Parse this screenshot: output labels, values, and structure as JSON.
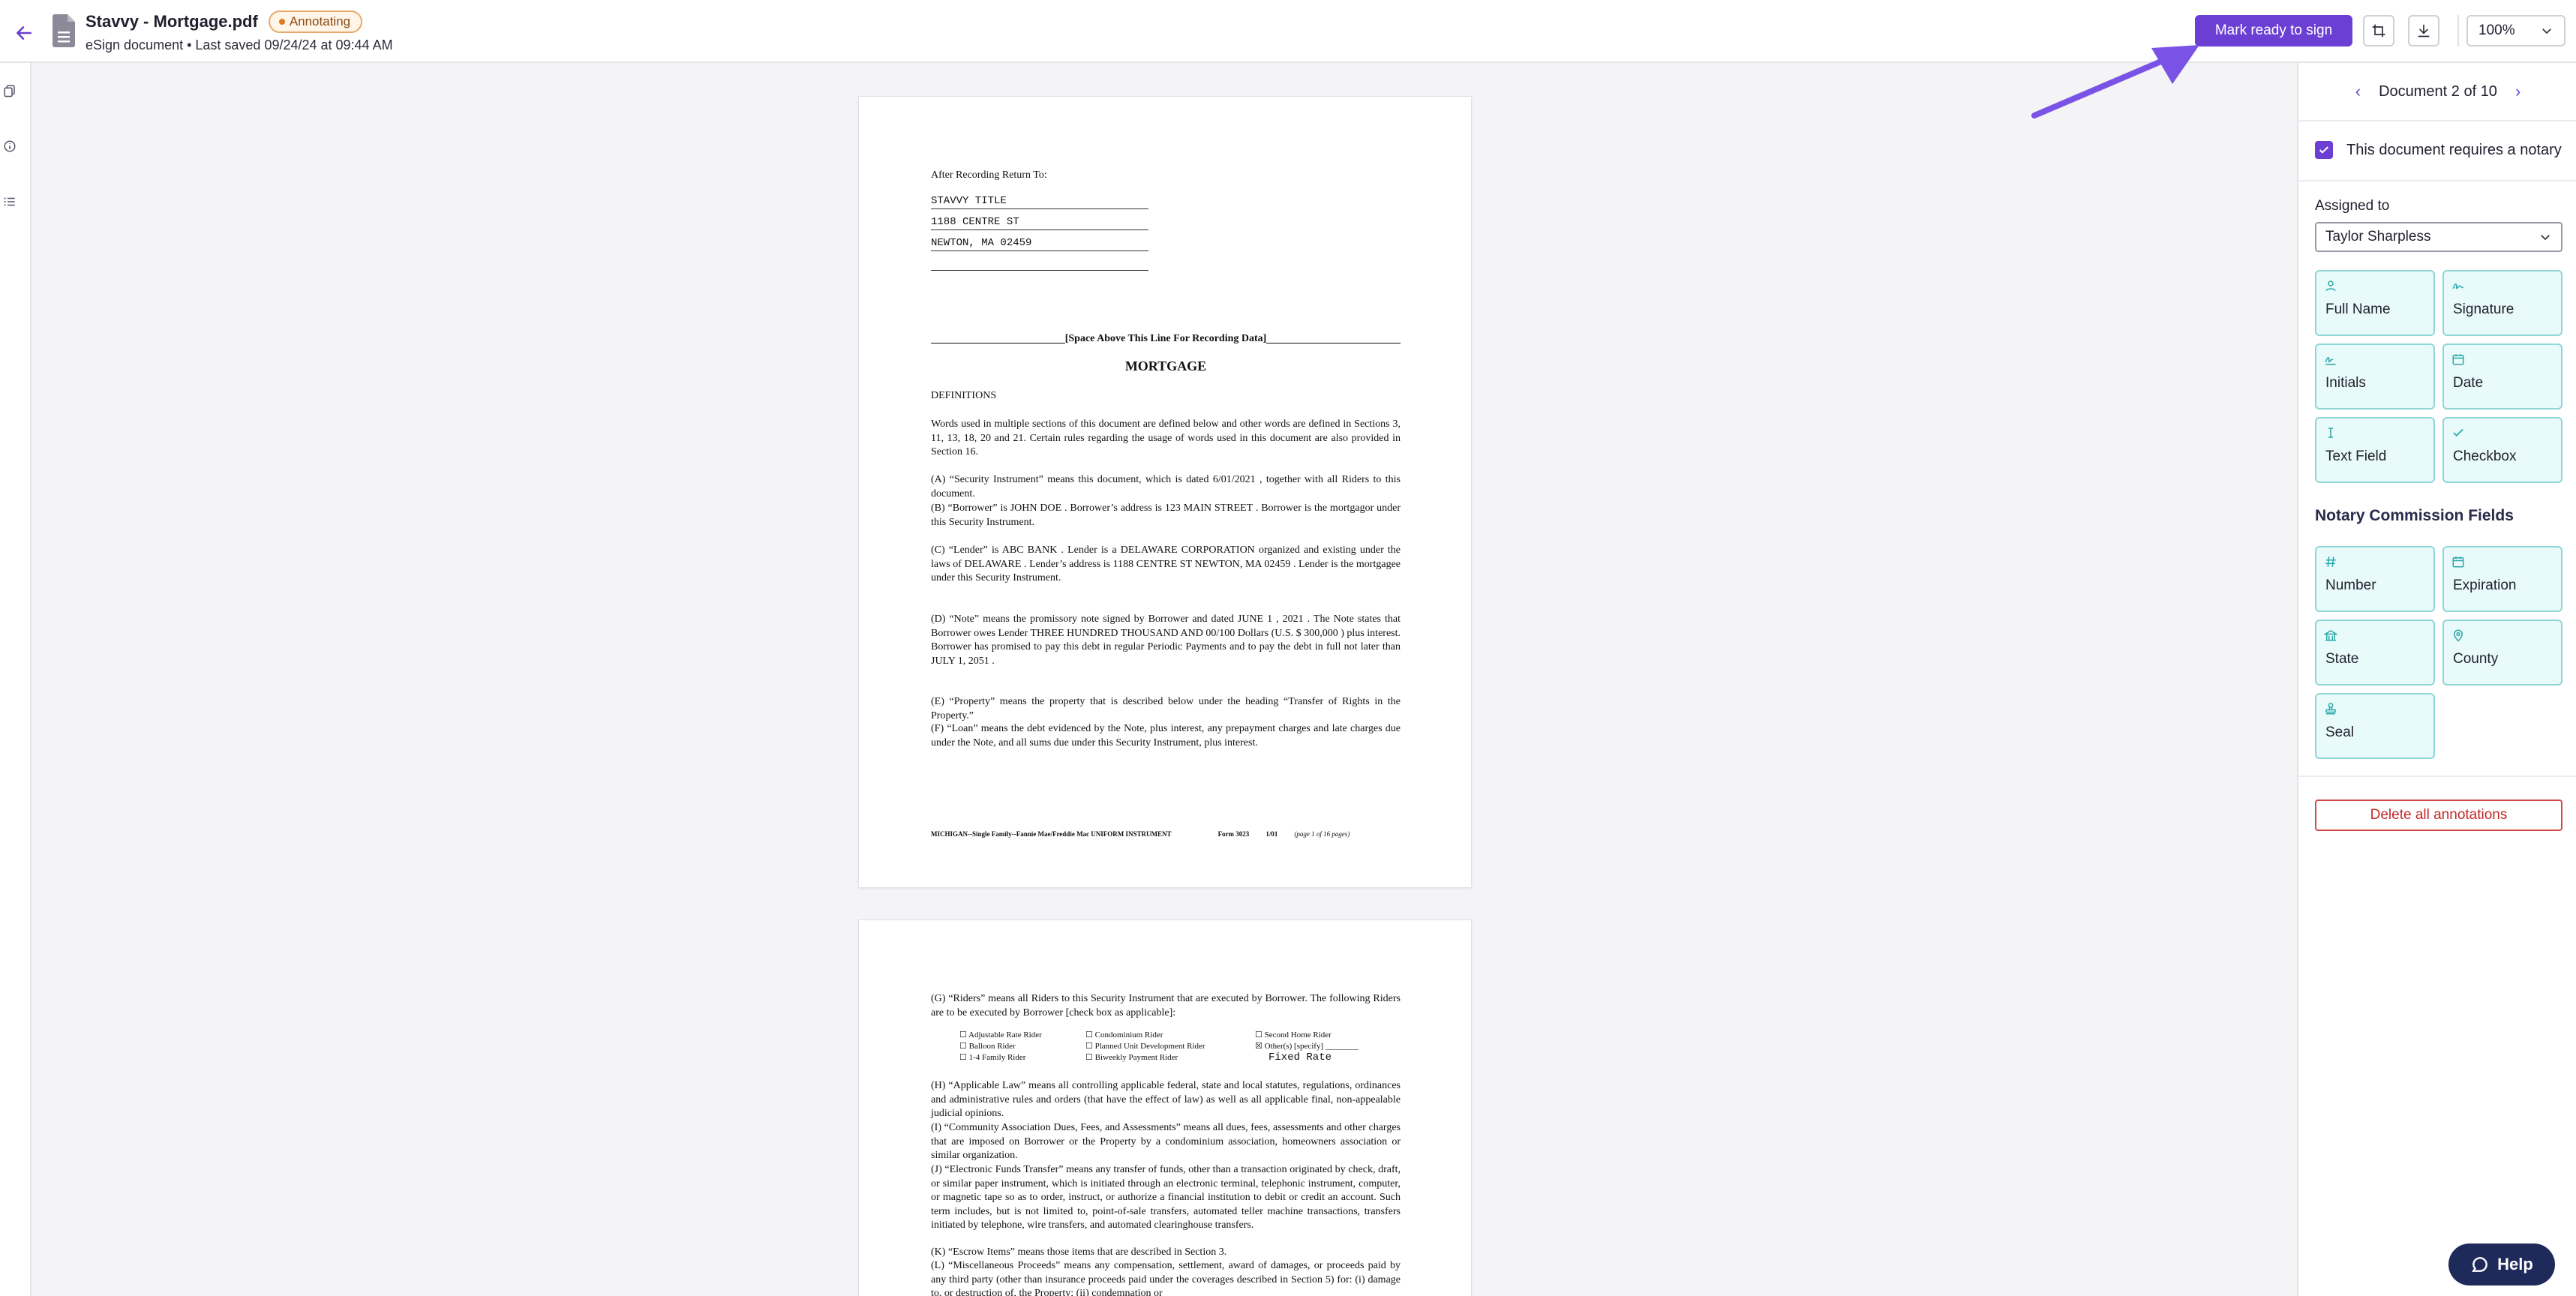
{
  "header": {
    "title": "Stavvy - Mortgage.pdf",
    "badge": "Annotating",
    "subtitle": "eSign document • Last saved 09/24/24 at 09:44 AM",
    "primary_button": "Mark ready to sign",
    "zoom": "100%"
  },
  "colors": {
    "accent": "#6b3fd4",
    "tile_bg": "#e9fafa",
    "tile_border": "#8fd6d6",
    "danger": "#c02a2a",
    "badge": "#e6a96a"
  },
  "icons": {
    "back": "arrow-left-icon",
    "file": "document-icon",
    "crop": "crop-icon",
    "download": "download-icon",
    "chevron": "chevron-down-icon",
    "help": "chat-bubble-icon"
  },
  "panel": {
    "doc_nav": "Document 2 of 10",
    "notary_label": "This document requires a notary",
    "assigned_label": "Assigned to",
    "assigned_value": "Taylor Sharpless",
    "fields": [
      "Full Name",
      "Signature",
      "Initials",
      "Date",
      "Text Field",
      "Checkbox"
    ],
    "notary_section": "Notary Commission Fields",
    "notary_fields": [
      "Number",
      "Expiration",
      "State",
      "County",
      "Seal"
    ],
    "delete_button": "Delete all annotations"
  },
  "help_label": "Help",
  "doc": {
    "return_to": "After Recording Return To:",
    "addr1": "STAVVY TITLE",
    "addr2": "1188 CENTRE ST",
    "addr3": "NEWTON, MA 02459",
    "space_above": "[Space Above This Line For Recording Data]",
    "heading": "MORTGAGE",
    "definitions": "DEFINITIONS",
    "intro": "Words used in multiple sections of this document are defined below and other words are defined in Sections 3, 11, 13, 18, 20 and 21.  Certain rules regarding the usage of words used in this document are also provided in Section 16.",
    "a": "(A)     “Security Instrument” means this document, which is dated  6/01/2021  , together with all Riders to this document.",
    "b": "(B)     “Borrower” is  JOHN DOE  . Borrower’s address is  123 MAIN STREET  . Borrower is the mortgagor under this Security Instrument.",
    "c": "(C)     “Lender” is  ABC BANK  . Lender is a  DELAWARE CORPORATION  organized and existing under the laws of  DELAWARE  . Lender’s address is  1188 CENTRE ST  NEWTON, MA 02459  . Lender is the mortgagee under this Security Instrument.",
    "d": "(D)     “Note” means the promissory note signed by Borrower and dated  JUNE 1 ,  2021  . The Note states that Borrower owes Lender  THREE HUNDRED THOUSAND AND 00/100  Dollars (U.S. $ 300,000  ) plus interest. Borrower has promised to pay this debt in regular Periodic Payments and to pay the debt in full not later than  JULY 1, 2051  .",
    "e": "(E)     “Property” means the property that is described below under the heading “Transfer of Rights in the Property.”",
    "f": "(F)     “Loan” means the debt evidenced by the Note, plus interest, any prepayment charges and late charges due under the Note, and all sums due under this Security Instrument, plus interest.",
    "footer_left": "MICHIGAN--Single Family--Fannie Mae/Freddie Mac UNIFORM INSTRUMENT",
    "footer_form": "Form 3023",
    "footer_date": "1/01",
    "footer_page": "(page 1 of 16 pages)",
    "g": "(G)     “Riders” means all Riders to this Security Instrument that are executed by Borrower. The following Riders are to be executed by Borrower [check box as applicable]:",
    "riders_col1": [
      "Adjustable Rate Rider",
      "Balloon Rider",
      "1-4 Family Rider"
    ],
    "riders_col2": [
      "Condominium Rider",
      "Planned Unit Development Rider",
      "Biweekly Payment Rider"
    ],
    "riders_col3": [
      "Second Home Rider",
      "Other(s) [specify]"
    ],
    "rider_other": "Fixed Rate",
    "h": "(H)     “Applicable Law” means all controlling applicable federal, state and local statutes, regulations, ordinances and administrative rules and orders (that have the effect of law) as well as all applicable final, non-appealable judicial opinions.",
    "i": "(I)     “Community Association Dues, Fees, and Assessments” means all dues, fees, assessments and other charges that are imposed on Borrower or the Property by a condominium association, homeowners association or similar organization.",
    "j": "(J)     “Electronic Funds Transfer” means any transfer of funds, other than a transaction originated by check, draft, or similar paper instrument, which is initiated through an electronic terminal, telephonic instrument, computer, or magnetic tape so as to order, instruct, or authorize a financial institution to debit or credit an account.  Such term includes, but is not limited to, point-of-sale transfers, automated teller machine transactions, transfers initiated by telephone, wire transfers, and automated clearinghouse transfers.",
    "k": "(K)     “Escrow Items” means those items that are described in Section 3.",
    "l": "(L)     “Miscellaneous Proceeds” means any compensation, settlement, award of damages, or proceeds paid by any third party (other than insurance proceeds paid under the coverages described in Section 5) for: (i) damage to, or destruction of, the Property; (ii) condemnation or"
  }
}
